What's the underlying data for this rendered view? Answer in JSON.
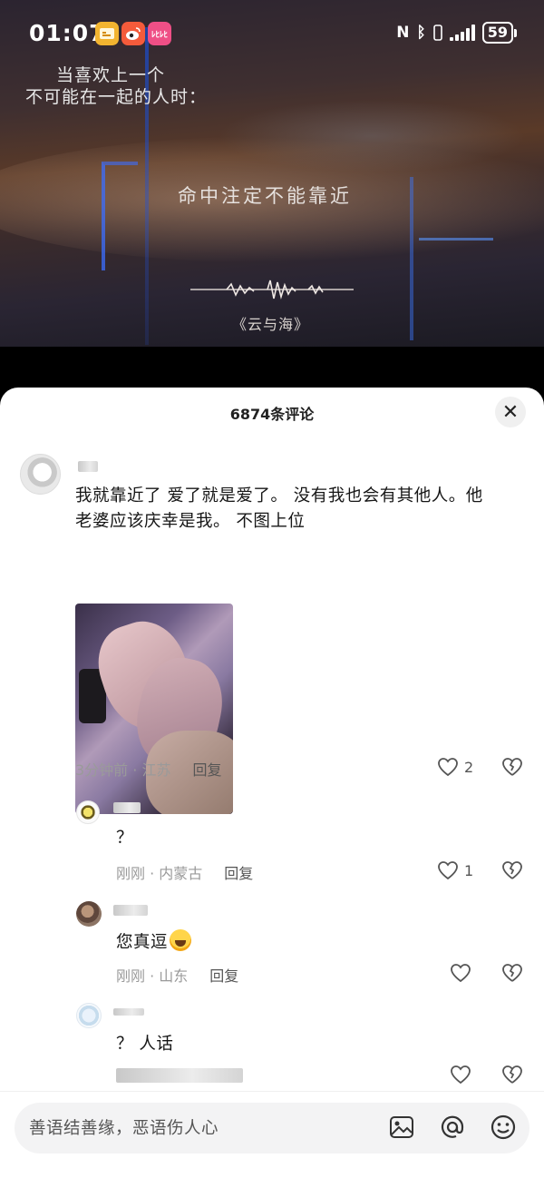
{
  "status_bar": {
    "time": "01:07",
    "badges": [
      "notes",
      "weibo",
      "app"
    ],
    "badge_app_label": "ﾚﾋﾚﾋ",
    "nfc_label": "N",
    "bt_label": "ᛒ",
    "battery": "59"
  },
  "video": {
    "overlay_line1": "当喜欢上一个",
    "overlay_line2": "不可能在一起的人时：",
    "lyric": "命中注定不能靠近",
    "song_title": "《云与海》"
  },
  "comments_header": {
    "title": "6874条评论",
    "close_label": "✕"
  },
  "comments": [
    {
      "text_line1": "我就靠近了 爱了就是爱了。 没有我也会有其他人。他",
      "text_line2": "老婆应该庆幸是我。 不图上位",
      "meta": "3分钟前 · 江苏",
      "reply_label": "回复",
      "likes": "2",
      "has_image": true,
      "replies": [
        {
          "text": "？",
          "meta": "刚刚 · 内蒙古",
          "reply_label": "回复",
          "likes": "1"
        },
        {
          "text": "您真逗",
          "meta": "刚刚 · 山东",
          "reply_label": "回复",
          "likes": ""
        },
        {
          "text": "？ 人话",
          "meta": "",
          "reply_label": "",
          "likes": ""
        }
      ]
    }
  ],
  "input": {
    "placeholder": "善语结善缘，恶语伤人心",
    "icons": [
      "image-icon",
      "at-icon",
      "emoji-icon"
    ]
  },
  "colors": {
    "sheet_bg": "#ffffff",
    "meta_gray": "#9a9a9a",
    "text": "#161616"
  }
}
